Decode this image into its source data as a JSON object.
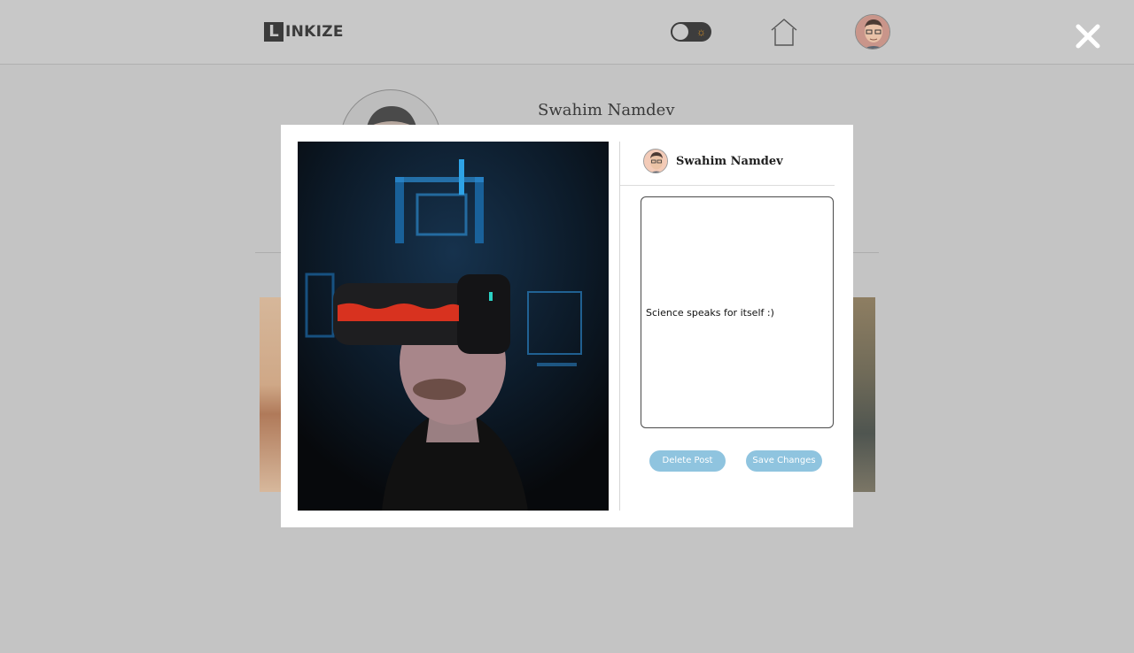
{
  "app": {
    "logo_mark": "L",
    "logo_text": "INKIZE"
  },
  "header": {
    "theme_toggle": {
      "state": "light",
      "icon": "sun-icon",
      "accent": "#d99224"
    },
    "home_icon": "home-icon",
    "avatar_icon": "user-avatar-icon",
    "close_icon": "close-icon"
  },
  "profile": {
    "name": "Swahim Namdev"
  },
  "modal": {
    "author_name": "Swahim Namdev",
    "caption": "Science speaks for itself :)",
    "image_alt": "VR headset photo",
    "delete_label": "Delete Post",
    "save_label": "Save Changes",
    "button_color": "#8fc4df"
  }
}
